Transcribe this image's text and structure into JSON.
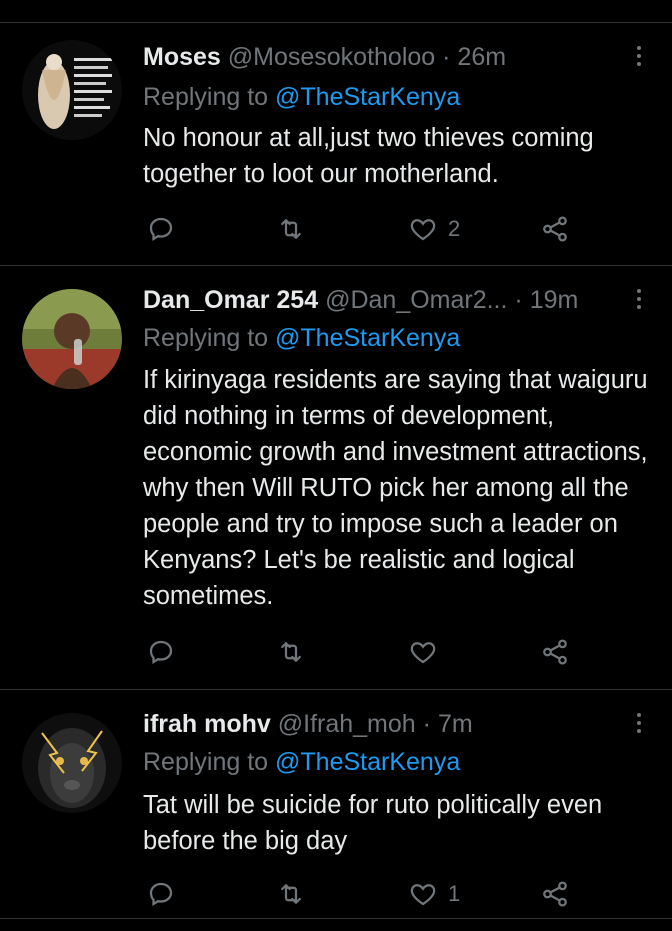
{
  "tweets": [
    {
      "name": "Moses",
      "handle": "@Mosesokotholoo",
      "time": "26m",
      "reply_prefix": "Replying to",
      "reply_to": "@TheStarKenya",
      "text": "No honour at all,just two thieves coming together to loot our motherland.",
      "likes": "2",
      "avatar_icon": "religious-image-avatar"
    },
    {
      "name": "Dan_Omar 254",
      "handle": "@Dan_Omar2...",
      "time": "19m",
      "reply_prefix": "Replying to",
      "reply_to": "@TheStarKenya",
      "text": "If kirinyaga  residents are saying that waiguru did nothing in terms of development, economic growth and investment attractions, why then Will RUTO pick her among all the people and try to impose such a leader on Kenyans? Let's be realistic and logical sometimes.",
      "likes": "",
      "avatar_icon": "child-photo-avatar"
    },
    {
      "name": "ifrah mohv",
      "handle": "@Ifrah_moh",
      "time": "7m",
      "reply_prefix": "Replying to",
      "reply_to": "@TheStarKenya",
      "text": "Tat will be suicide for ruto politically even before the big day",
      "likes": "1",
      "avatar_icon": "lion-avatar"
    }
  ],
  "separator": "·",
  "colors": {
    "background": "#000000",
    "text": "#e7e9ea",
    "muted": "#71767b",
    "accent": "#1d9bf0",
    "divider": "#2f3336"
  }
}
